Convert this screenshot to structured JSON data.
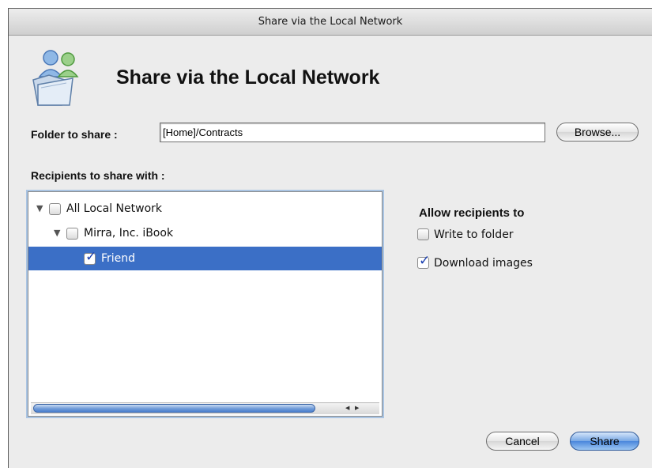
{
  "window": {
    "title": "Share via the Local Network"
  },
  "header": {
    "icon": "shared-folder-people-icon",
    "title": "Share via the Local Network"
  },
  "folder": {
    "label": "Folder to share :",
    "value": "[Home]/Contracts",
    "browse_label": "Browse..."
  },
  "recipients": {
    "label": "Recipients to share with :",
    "tree": [
      {
        "label": "All Local Network",
        "level": 0,
        "expanded": true,
        "checked": false,
        "selected": false
      },
      {
        "label": "Mirra, Inc. iBook",
        "level": 1,
        "expanded": true,
        "checked": false,
        "selected": false
      },
      {
        "label": "Friend",
        "level": 2,
        "checked": true,
        "selected": true
      }
    ]
  },
  "permissions": {
    "label": "Allow recipients to",
    "options": [
      {
        "label": "Write to folder",
        "checked": false
      },
      {
        "label": "Download images",
        "checked": true
      }
    ]
  },
  "footer": {
    "cancel_label": "Cancel",
    "share_label": "Share"
  },
  "colors": {
    "selection": "#3b6fc6",
    "accent": "#4a86dc"
  }
}
